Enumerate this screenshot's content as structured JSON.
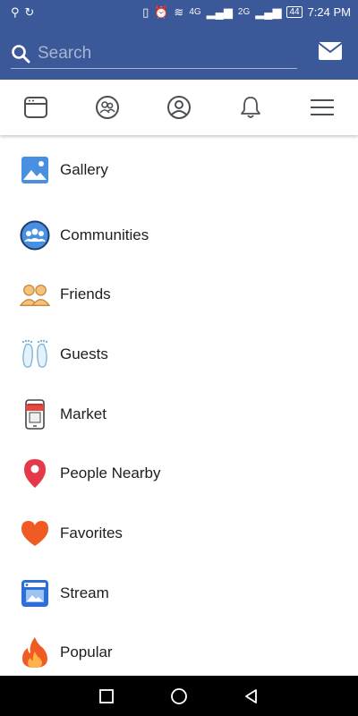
{
  "status_bar": {
    "time": "7:24 PM",
    "battery": "44",
    "net1": "4G",
    "net2": "2G"
  },
  "search": {
    "placeholder": "Search"
  },
  "menu": {
    "items": [
      {
        "label": "Gallery",
        "icon": "gallery-icon"
      },
      {
        "label": "Communities",
        "icon": "communities-icon"
      },
      {
        "label": "Friends",
        "icon": "friends-icon"
      },
      {
        "label": "Guests",
        "icon": "guests-icon"
      },
      {
        "label": "Market",
        "icon": "market-icon"
      },
      {
        "label": "People Nearby",
        "icon": "location-pin-icon"
      },
      {
        "label": "Favorites",
        "icon": "heart-icon"
      },
      {
        "label": "Stream",
        "icon": "stream-icon"
      },
      {
        "label": "Popular",
        "icon": "flame-icon"
      }
    ]
  },
  "colors": {
    "brand": "#3b5998"
  }
}
